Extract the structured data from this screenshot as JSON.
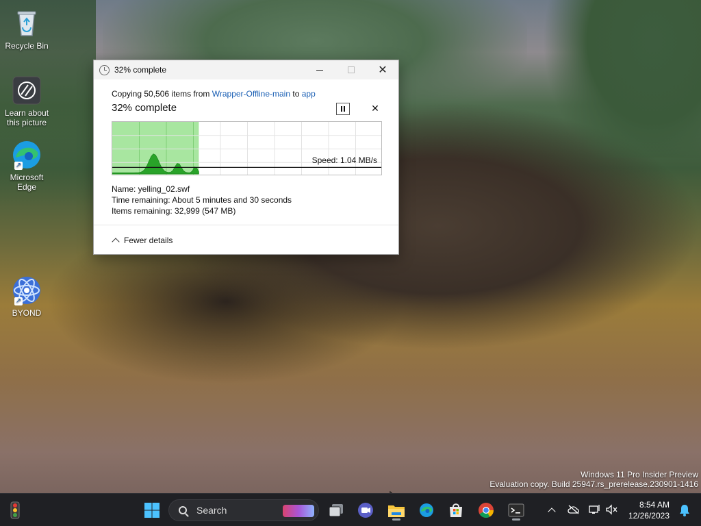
{
  "desktop": {
    "icons": [
      {
        "label": "Recycle Bin",
        "icon": "recycle-bin-icon"
      },
      {
        "label": "Learn about this picture",
        "icon": "camera-icon"
      },
      {
        "label": "Microsoft Edge",
        "icon": "edge-icon"
      },
      {
        "label": "BYOND",
        "icon": "byond-icon"
      }
    ]
  },
  "dialog": {
    "title": "32% complete",
    "copying_prefix": "Copying 50,506 items from",
    "source": "Wrapper-Offline-main",
    "to_word": "to",
    "destination": "app",
    "headline": "32% complete",
    "progress_fraction": 0.32,
    "speed": "Speed: 1.04 MB/s",
    "name_row": "Name:  yelling_02.swf",
    "time_row": "Time remaining:  About 5 minutes and 30 seconds",
    "items_row": "Items remaining:  32,999 (547 MB)",
    "fewer_details": "Fewer details"
  },
  "watermark": {
    "line1": "Windows 11 Pro Insider Preview",
    "line2": "Evaluation copy. Build 25947.rs_prerelease.230901-1416"
  },
  "taskbar": {
    "search_label": "Search",
    "apps": [
      "widgets-icon",
      "start-icon",
      "task-view-icon",
      "teams-icon",
      "file-explorer-icon",
      "edge-icon",
      "store-icon",
      "chrome-icon",
      "terminal-icon"
    ],
    "time": "8:54 AM",
    "date": "12/26/2023"
  },
  "colors": {
    "accent_link": "#1a5fb4",
    "progress_fill": "#a8e6a0",
    "graph_green": "#29a329"
  }
}
